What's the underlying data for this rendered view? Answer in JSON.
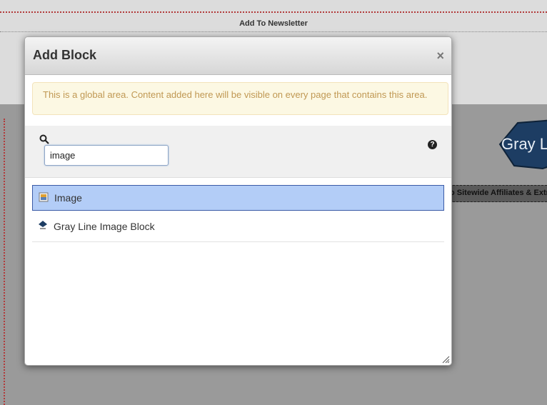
{
  "background": {
    "newsletter_label": "Add To Newsletter",
    "affiliates_label": "o Sitewide Affiliates & Extr",
    "logo_text": "Gray L"
  },
  "dialog": {
    "title": "Add Block",
    "close_label": "×",
    "alert": "This is a global area. Content added here will be visible on every page that contains this area.",
    "search": {
      "value": "image",
      "help_label": "?"
    },
    "results": [
      {
        "label": "Image",
        "selected": true,
        "icon": "image-block-icon"
      },
      {
        "label": "Gray Line Image Block",
        "selected": false,
        "icon": "gray-line-logo-icon"
      }
    ]
  }
}
